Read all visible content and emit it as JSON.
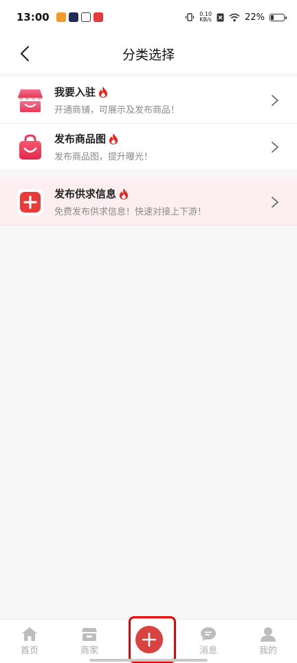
{
  "status_bar": {
    "time": "13:00",
    "net_speed_value": "0.10",
    "net_speed_unit": "KB/s",
    "battery_text": "22%",
    "battery_level": 0.22,
    "app_icon_colors": [
      "#f39a2b",
      "#222a55",
      "#3a3a3a",
      "#e23a3a"
    ]
  },
  "header": {
    "title": "分类选择"
  },
  "options": [
    {
      "title": "我要入驻",
      "subtitle": "开通商铺，可展示及发布商品！",
      "icon": "storefront-icon"
    },
    {
      "title": "发布商品图",
      "subtitle": "发布商品图，提升曝光！",
      "icon": "shopping-bag-icon"
    },
    {
      "title": "发布供求信息",
      "subtitle": "免费发布供求信息！快速对接上下游！",
      "icon": "plus-square-icon"
    }
  ],
  "bottom_nav": {
    "home": "首页",
    "merchant": "商家",
    "messages": "消息",
    "mine": "我的"
  },
  "colors": {
    "accent_red": "#d9423f",
    "highlight_pink": "#fdeff1",
    "icon_pink": "#f04a6c"
  }
}
